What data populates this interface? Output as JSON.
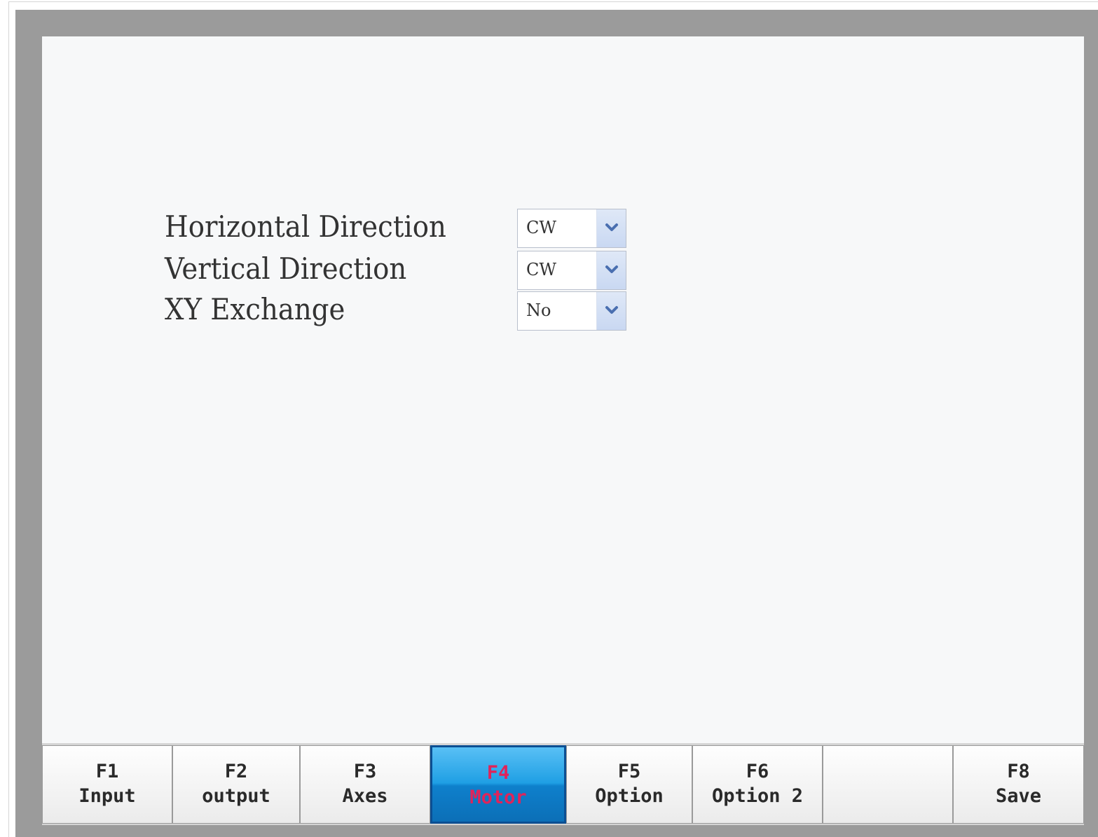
{
  "form": {
    "rows": [
      {
        "label": "Horizontal Direction",
        "value": "CW"
      },
      {
        "label": "Vertical Direction",
        "value": "CW"
      },
      {
        "label": "XY Exchange",
        "value": "No"
      }
    ]
  },
  "function_keys": [
    {
      "key": "F1",
      "label": "Input"
    },
    {
      "key": "F2",
      "label": "output"
    },
    {
      "key": "F3",
      "label": "Axes"
    },
    {
      "key": "F4",
      "label": "Motor"
    },
    {
      "key": "F5",
      "label": "Option"
    },
    {
      "key": "F6",
      "label": "Option 2"
    },
    {
      "key": "",
      "label": ""
    },
    {
      "key": "F8",
      "label": "Save"
    }
  ],
  "active_function_key": "F4",
  "colors": {
    "bezel": "#9b9b9b",
    "screen_background": "#f7f8f9",
    "active_key_blue": "#1f9fe4",
    "active_key_text": "#e0245a",
    "dropdown_arrow": "#4a6fb0"
  },
  "icons": {
    "dropdown": "chevron-down-icon"
  }
}
